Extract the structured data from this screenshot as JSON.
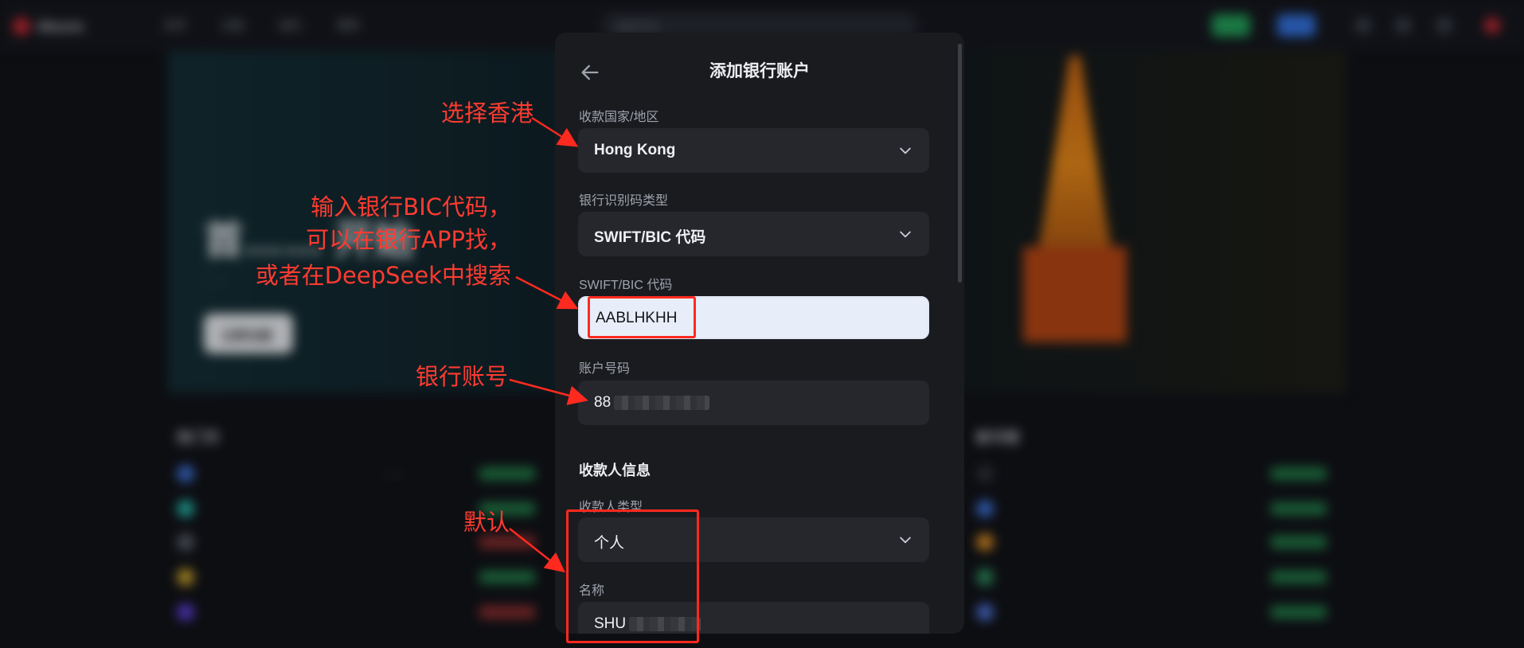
{
  "background": {
    "brand": "Bitunix",
    "nav": [
      "买币",
      "交易",
      "合约",
      "更多"
    ],
    "search_placeholder": "搜索币种",
    "banner_title": "首…… 开始",
    "banner_sub": "……",
    "banner_button": "立即注册",
    "left_section": "热门币",
    "right_section": "新币榜"
  },
  "dialog": {
    "title": "添加银行账户",
    "country_label": "收款国家/地区",
    "country_value": "Hong Kong",
    "bank_code_type_label": "银行识别码类型",
    "bank_code_type_value": "SWIFT/BIC 代码",
    "swift_label": "SWIFT/BIC 代码",
    "swift_value": "AABLHKHH",
    "account_label": "账户号码",
    "account_value_visible": "88",
    "payee_section_title": "收款人信息",
    "payee_type_label": "收款人类型",
    "payee_type_value": "个人",
    "name_label": "名称",
    "name_value_visible": "SHU"
  },
  "annotations": {
    "select_hk": "选择香港",
    "bic_line1": "输入银行BIC代码，",
    "bic_line2": "可以在银行APP找，",
    "bic_line3": "或者在DeepSeek中搜索",
    "account": "银行账号",
    "default": "默认",
    "color": "#ff2a1f"
  },
  "icons": {
    "back": "back-arrow-icon",
    "chevron": "chevron-down-icon"
  }
}
